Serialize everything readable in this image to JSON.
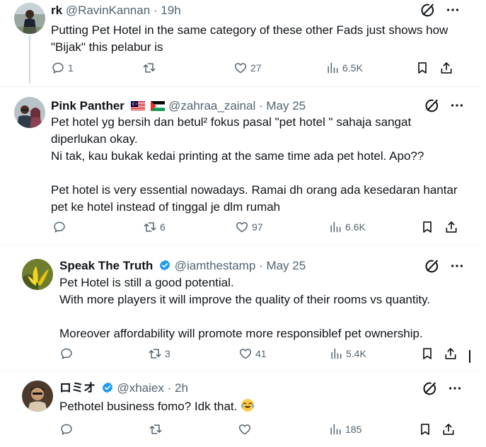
{
  "tweets": [
    {
      "name": "rk",
      "handle": "@RavinKannan",
      "dot": "·",
      "time": "19h",
      "lines": [
        "Putting Pet Hotel in the same category of these other Fads just shows how",
        "\"Bijak\" this pelabur is"
      ],
      "replies": "1",
      "reposts": "",
      "likes": "27",
      "views": "6.5K"
    },
    {
      "name": "Pink Panther",
      "handle": "@zahraa_zainal",
      "dot": "·",
      "time": "May 25",
      "lines": [
        "Pet hotel yg bersih dan betul² fokus pasal \"pet hotel \" sahaja sangat",
        "diperlukan okay.",
        "Ni tak, kau bukak kedai printing at the same time ada pet hotel. Apo??",
        "",
        "Pet hotel is very essential nowadays. Ramai dh orang ada kesedaran hantar",
        "pet ke hotel instead of tinggal je dlm rumah"
      ],
      "replies": "",
      "reposts": "6",
      "likes": "97",
      "views": "6.6K"
    },
    {
      "name": "Speak The Truth",
      "handle": "@iamthestamp",
      "dot": "·",
      "time": "May 25",
      "lines": [
        "Pet Hotel is still a good potential.",
        "With more players it will improve the quality of their rooms vs quantity.",
        "",
        "Moreover affordability will promote more responsiblef pet ownership."
      ],
      "replies": "",
      "reposts": "3",
      "likes": "41",
      "views": "5.4K"
    },
    {
      "name": "ロミオ",
      "handle": "@xhaiex",
      "dot": "·",
      "time": "2h",
      "lines": [
        "Pethotel business fomo? Idk that."
      ],
      "replies": "",
      "reposts": "",
      "likes": "",
      "views": "185"
    }
  ],
  "colors": {
    "text": "#0f1419",
    "muted": "#536471",
    "verified": "#1d9bf0",
    "divider": "#eff3f4"
  },
  "icons": [
    "grok-icon",
    "more-icon",
    "reply-icon",
    "repost-icon",
    "like-icon",
    "views-icon",
    "bookmark-icon",
    "share-icon",
    "verified-badge-icon",
    "malaysia-flag-icon",
    "palestine-flag-icon",
    "laughing-emoji-icon"
  ]
}
